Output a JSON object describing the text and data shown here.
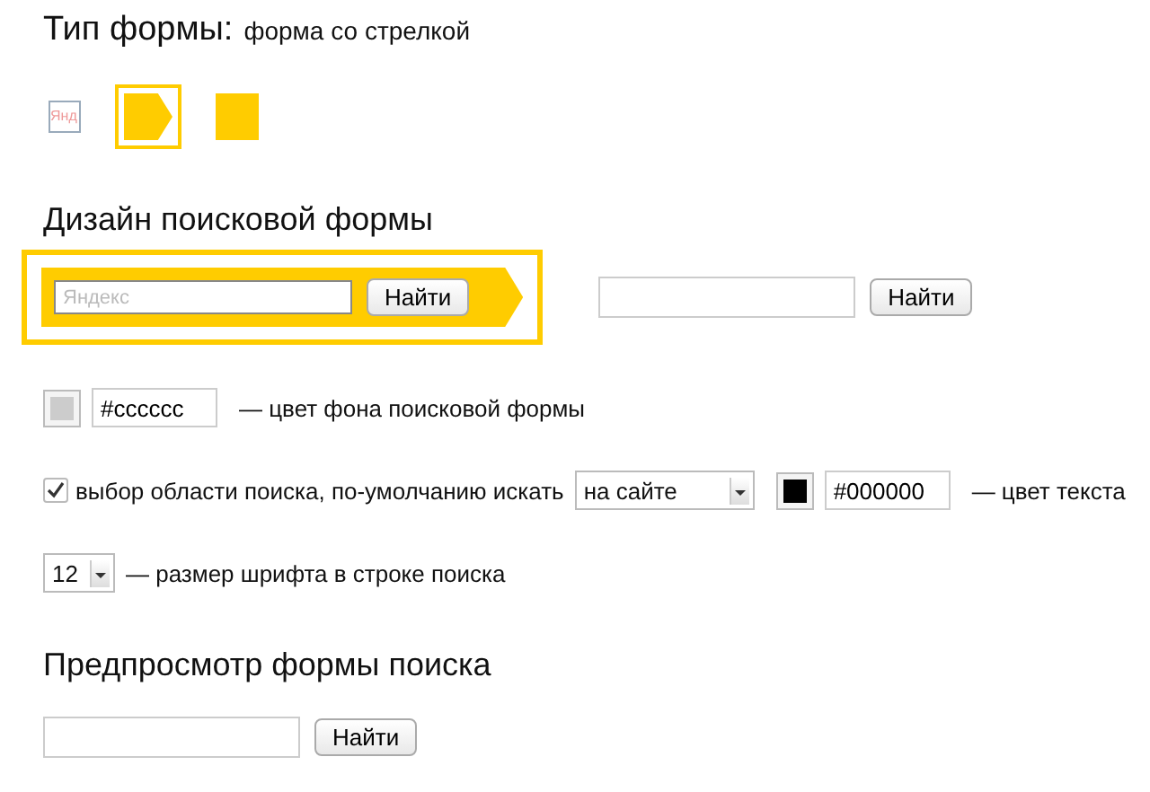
{
  "form_type": {
    "label": "Тип формы:",
    "value": "форма со стрелкой",
    "options": [
      {
        "kind": "plain",
        "text": "Янд",
        "selected": false
      },
      {
        "kind": "arrow",
        "selected": true
      },
      {
        "kind": "square",
        "selected": false
      }
    ]
  },
  "design": {
    "title": "Дизайн поисковой формы",
    "variants": [
      {
        "kind": "arrow",
        "placeholder": "Яндекс",
        "button": "Найти",
        "selected": true
      },
      {
        "kind": "plain",
        "button": "Найти",
        "selected": false
      }
    ]
  },
  "settings": [
    {
      "kind": "color",
      "color": "#cccccc",
      "value": "#cccccc",
      "label": "— цвет фона поисковой формы"
    },
    {
      "kind": "area",
      "checked": true,
      "label": "выбор области поиска, по-умолчанию искать",
      "select": "на сайте",
      "color": "#000000",
      "value": "#000000",
      "color_label": "— цвет текста"
    },
    {
      "kind": "size",
      "select": "12",
      "label": "— размер шрифта в строке поиска"
    }
  ],
  "preview": {
    "title": "Предпросмотр формы поиска",
    "button": "Найти"
  }
}
